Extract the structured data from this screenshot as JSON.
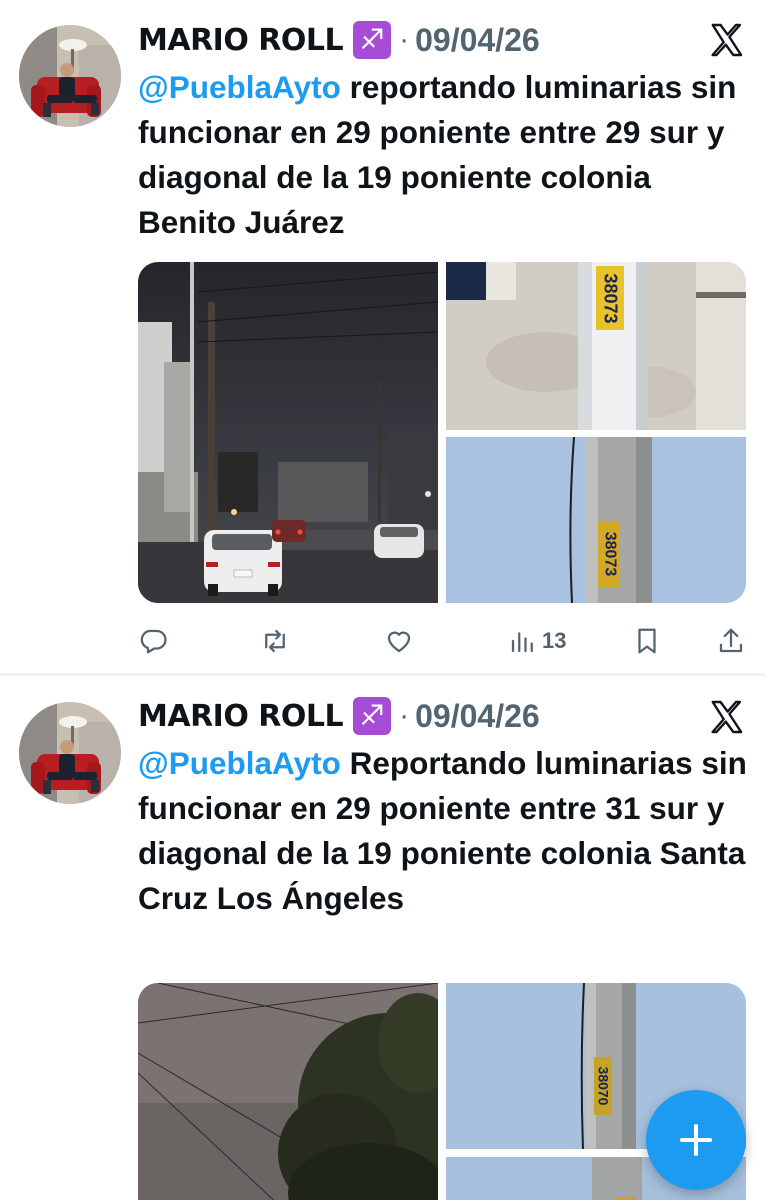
{
  "tweets": [
    {
      "author": "MARIO ROLL",
      "zodiac_glyph": "♐",
      "separator": "·",
      "date": "09/04/26",
      "mention": "@PueblaAyto",
      "text": " reportando luminarias sin funcionar en 29 poniente entre 29 sur y diagonal de la 19 poniente colonia Benito Juárez",
      "pole_label_top": "38073",
      "pole_label_bottom": "38073",
      "metrics": {
        "views": "13"
      }
    },
    {
      "author": "MARIO ROLL",
      "zodiac_glyph": "♐",
      "separator": "·",
      "date": "09/04/26",
      "mention": "@PueblaAyto",
      "text": " Reportando luminarias sin funcionar en 29 poniente entre 31 sur y diagonal de la 19 poniente colonia Santa Cruz Los Ángeles",
      "pole_label_top": "38070"
    }
  ],
  "icons": {
    "reply": "reply-icon",
    "retweet": "retweet-icon",
    "like": "heart-icon",
    "views": "views-icon",
    "bookmark": "bookmark-icon",
    "share": "share-icon",
    "x_logo": "x-logo-icon",
    "compose": "plus-icon"
  },
  "colors": {
    "accent": "#1d9bf0",
    "text": "#0f1419",
    "secondary": "#536471",
    "zodiac": "#a64dd6"
  }
}
